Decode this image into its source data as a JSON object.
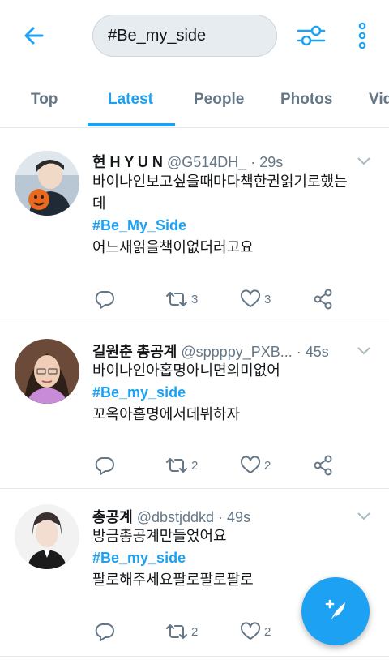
{
  "search": {
    "query": "#Be_my_side"
  },
  "tabs": [
    {
      "label": "Top",
      "active": false
    },
    {
      "label": "Latest",
      "active": true
    },
    {
      "label": "People",
      "active": false
    },
    {
      "label": "Photos",
      "active": false
    },
    {
      "label": "Vid",
      "active": false
    }
  ],
  "tweets": [
    {
      "name": "현 H Y U N",
      "handle": "@G514DH_",
      "time": "· 29s",
      "lines": [
        "바이나인보고싶을때마다책한권읽기로했는",
        "데"
      ],
      "hashtag": "#Be_My_Side",
      "after": "어느새읽을책이없더러고요",
      "replies": "",
      "retweets": "3",
      "likes": "3"
    },
    {
      "name": "길원춘 총공계",
      "handle": "@sppppy_PXB...",
      "time": "· 45s",
      "lines": [
        "바이나인아홉명아니면의미없어"
      ],
      "hashtag": "#Be_my_side",
      "after": "꼬옥아홉명에서데뷔하자",
      "replies": "",
      "retweets": "2",
      "likes": "2"
    },
    {
      "name": "총공계",
      "handle": "@dbstjddkd",
      "time": "· 49s",
      "lines": [
        "방금총공계만들었어요"
      ],
      "hashtag": "#Be_my_side",
      "after": "팔로해주세요팔로팔로팔로",
      "replies": "",
      "retweets": "2",
      "likes": "2"
    }
  ],
  "colors": {
    "accent": "#1da1f2",
    "muted": "#657786",
    "text": "#14171a"
  },
  "icons": {
    "back": "arrow-left-icon",
    "filter": "sliders-icon",
    "more": "vertical-dots-icon",
    "compose": "compose-feather-icon"
  }
}
